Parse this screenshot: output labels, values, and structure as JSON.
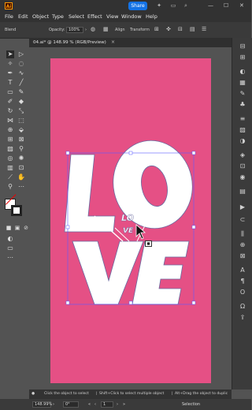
{
  "app": {
    "logo": "Ai",
    "share_label": "Share"
  },
  "menubar": [
    "File",
    "Edit",
    "Object",
    "Type",
    "Select",
    "Effect",
    "View",
    "Window",
    "Help"
  ],
  "control_bar": {
    "blend_label": "Blend",
    "opacity_label": "Opacity:",
    "opacity_value": "100%",
    "align_label": "Align",
    "transform_label": "Transform"
  },
  "document_tab": {
    "title": "04.ai* @ 148.99 % (RGB/Preview)",
    "close": "×"
  },
  "artwork": {
    "word_top": "LO",
    "word_bottom": "VE",
    "center_small": "LO",
    "center_small2": "VE",
    "bg_color": "#e55085"
  },
  "hint": {
    "part1": "Click the object to select",
    "part2": "Shift+Click to select multiple object",
    "part3": "Alt+Drag the object to duplic"
  },
  "statusbar": {
    "zoom": "148.99%",
    "rotation": "0°",
    "page": "1",
    "tool": "Selection"
  }
}
